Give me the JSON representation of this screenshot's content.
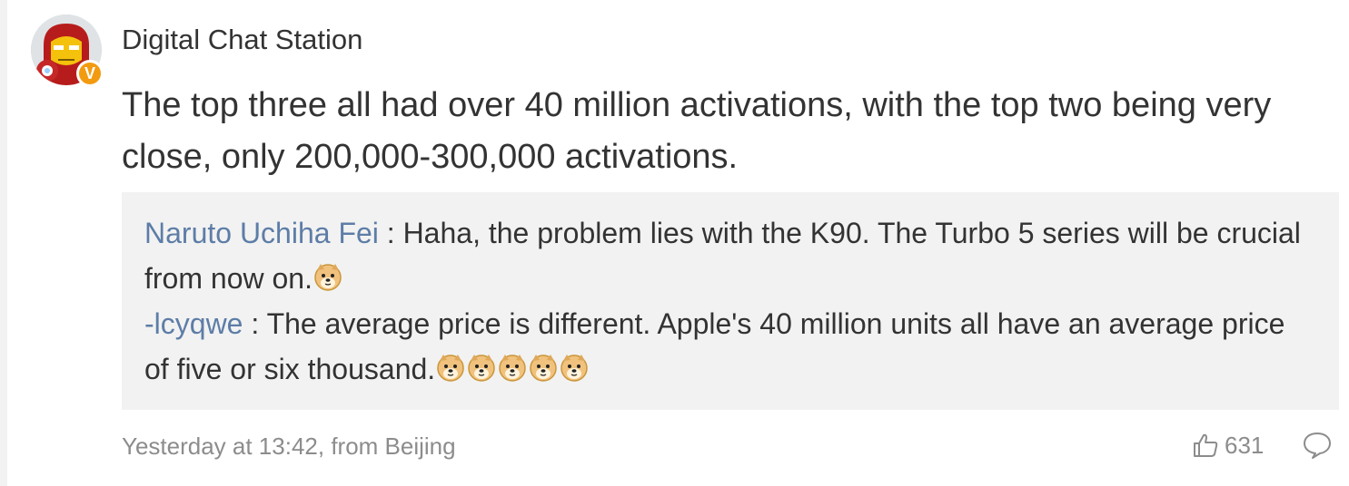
{
  "post": {
    "author": "Digital Chat Station",
    "verified_badge": "V",
    "content": "The top three all had over 40 million activations, with the top two being very close, only 200,000-300,000 activations.",
    "replies": [
      {
        "author": "Naruto Uchiha Fei",
        "separator": " : ",
        "text": "Haha, the problem lies with the K90. The Turbo 5 series will be crucial from now on.",
        "emoji_count": 1,
        "emoji_icon": "doge-emoji-icon"
      },
      {
        "author": "-lcyqwe",
        "separator": " : ",
        "text": "The average price is different. Apple's 40 million units all have an average price of five or six thousand.",
        "emoji_count": 5,
        "emoji_icon": "doge-emoji-icon"
      }
    ],
    "footer": {
      "timestamp": "Yesterday at 13:42, from Beijing",
      "likes": "631",
      "like_icon": "thumbs-up-icon",
      "comment_icon": "comment-bubble-icon"
    }
  },
  "colors": {
    "text": "#333333",
    "link": "#5d7da7",
    "muted": "#8c8c8c",
    "quote_bg": "#f2f2f2",
    "badge": "#f29b11"
  }
}
